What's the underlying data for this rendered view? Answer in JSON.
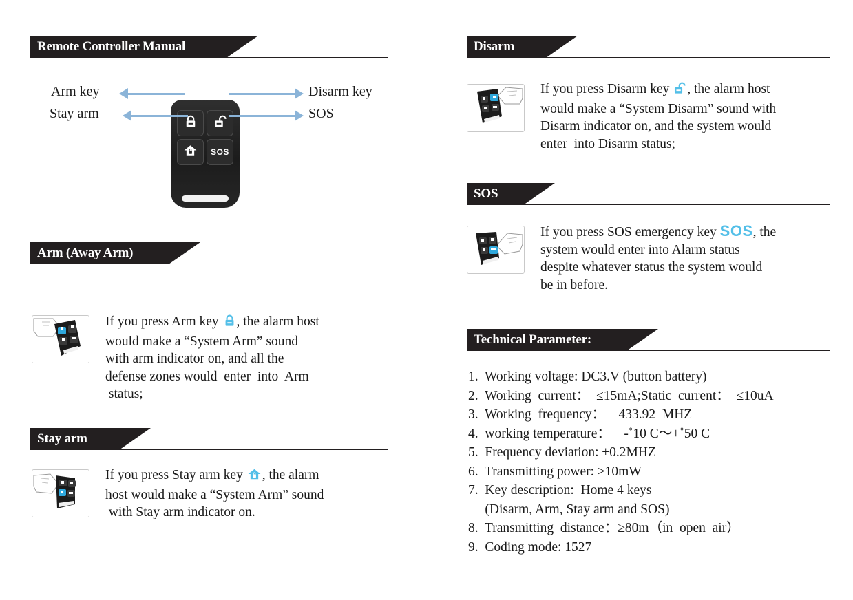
{
  "document": {
    "title": "Remote Controller Manual"
  },
  "colors": {
    "banner_bg": "#231f20",
    "banner_text": "#ffffff",
    "accent_blue": "#53bfe8",
    "arrow_blue": "#8bb4d8",
    "body_text": "#1a1a1a"
  },
  "left_column": {
    "sections": [
      {
        "id": "remote-controller-manual",
        "heading": "Remote Controller Manual"
      },
      {
        "id": "arm-away-arm",
        "heading": "Arm (Away Arm)",
        "body_before": "If you press Arm key ",
        "icon": "lock-icon",
        "body_after": ", the alarm host\nwould make a “System Arm” sound\nwith arm indicator on, and all the\ndefense zones would  enter  into  Arm\n status;",
        "thumbnail": "remote-hand-press-arm"
      },
      {
        "id": "stay-arm",
        "heading": "Stay arm",
        "body_before": "If you press Stay arm key ",
        "icon": "home-lock-icon",
        "body_after": ", the alarm\nhost would make a “System Arm” sound\n with Stay arm indicator on.",
        "thumbnail": "remote-hand-press-stay-arm"
      }
    ]
  },
  "right_column": {
    "sections": [
      {
        "id": "disarm",
        "heading": "Disarm",
        "body_before": "If you press Disarm key ",
        "icon": "unlock-icon",
        "body_after": ", the alarm host\nwould make a “System Disarm” sound with\nDisarm indicator on, and the system would\nenter  into Disarm status;",
        "thumbnail": "remote-hand-press-disarm"
      },
      {
        "id": "sos",
        "heading": "SOS",
        "body_before": "If you press SOS emergency key ",
        "icon": "sos-text-icon",
        "icon_label": "SOS",
        "body_after": ", the\nsystem would enter into Alarm status\ndespite whatever status the system would\nbe in before.",
        "thumbnail": "remote-hand-press-sos"
      },
      {
        "id": "technical-parameter",
        "heading": "Technical Parameter:",
        "items": [
          "1.  Working voltage: DC3.V (button battery)",
          "2.  Working  current：  ≤15mA;Static  current：  ≤10uA",
          "3.  Working  frequency：    433.92  MHZ",
          "4.  working temperature：    -˚10 C～+˚50 C",
          "5.  Frequency deviation: ±0.2MHZ",
          "6.  Transmitting power: ≥10mW",
          "7.  Key description:  Home 4 keys",
          "     (Disarm, Arm, Stay arm and SOS)",
          "8.  Transmitting  distance：≥80m（in  open  air）",
          "9.  Coding mode: 1527"
        ]
      }
    ]
  },
  "diagram": {
    "name": "remote-controller-diagram",
    "keys": [
      {
        "id": "arm",
        "icon": "lock-icon"
      },
      {
        "id": "disarm",
        "icon": "unlock-icon"
      },
      {
        "id": "stay-arm",
        "icon": "home-lock-icon"
      },
      {
        "id": "sos",
        "icon": "sos-text-icon",
        "label": "SOS"
      }
    ],
    "callouts": [
      {
        "id": "arm-key",
        "label": "Arm key",
        "side": "left"
      },
      {
        "id": "stay-arm",
        "label": "Stay arm",
        "side": "left"
      },
      {
        "id": "disarm-key",
        "label": "Disarm key",
        "side": "right"
      },
      {
        "id": "sos",
        "label": "SOS",
        "side": "right"
      }
    ]
  }
}
